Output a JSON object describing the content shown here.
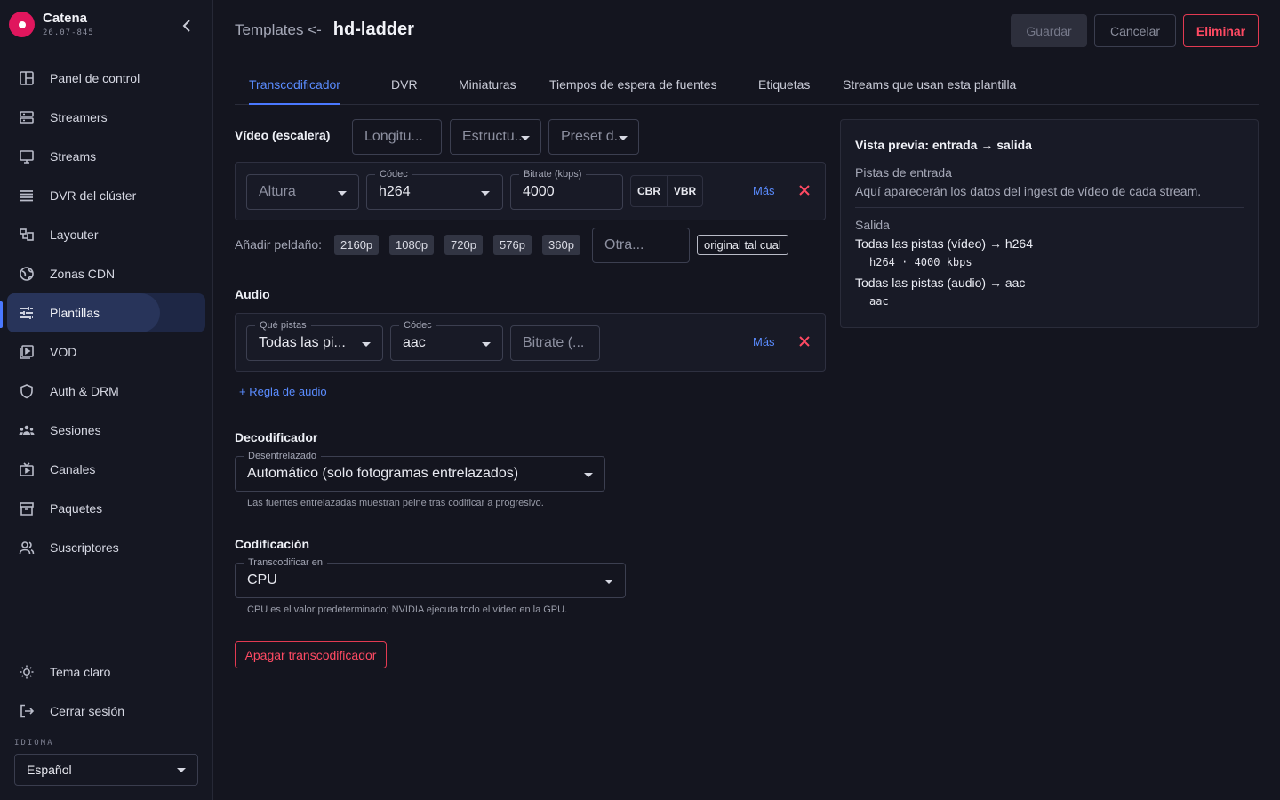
{
  "brand": {
    "name": "Catena",
    "version": "26.07-845",
    "logo_color": "#e0165d"
  },
  "sidebar": {
    "items": [
      {
        "label": "Panel de control",
        "icon": "dashboard-icon"
      },
      {
        "label": "Streamers",
        "icon": "server-icon"
      },
      {
        "label": "Streams",
        "icon": "monitor-icon"
      },
      {
        "label": "DVR del clúster",
        "icon": "list-icon"
      },
      {
        "label": "Layouter",
        "icon": "layout-icon"
      },
      {
        "label": "Zonas CDN",
        "icon": "globe-icon"
      },
      {
        "label": "Plantillas",
        "icon": "sliders-icon",
        "active": true
      },
      {
        "label": "VOD",
        "icon": "video-library-icon"
      },
      {
        "label": "Auth & DRM",
        "icon": "shield-icon"
      },
      {
        "label": "Sesiones",
        "icon": "group-icon"
      },
      {
        "label": "Canales",
        "icon": "tv-icon"
      },
      {
        "label": "Paquetes",
        "icon": "archive-icon"
      },
      {
        "label": "Suscriptores",
        "icon": "users-icon"
      }
    ],
    "theme_label": "Tema claro",
    "logout_label": "Cerrar sesión",
    "language_label": "IDIOMA",
    "language_value": "Español"
  },
  "header": {
    "breadcrumb": "Templates <-",
    "title": "hd-ladder",
    "save_label": "Guardar",
    "cancel_label": "Cancelar",
    "delete_label": "Eliminar"
  },
  "tabs": [
    {
      "label": "Transcodificador",
      "active": true
    },
    {
      "label": "DVR"
    },
    {
      "label": "Miniaturas"
    },
    {
      "label": "Tiempos de espera de fuentes"
    },
    {
      "label": "Etiquetas"
    },
    {
      "label": "Streams que usan esta plantilla"
    }
  ],
  "video": {
    "title": "Vídeo (escalera)",
    "gop_placeholder": "Longitu...",
    "structure_placeholder": "Estructu...",
    "preset_placeholder": "Preset d...",
    "row": {
      "height_placeholder": "Altura",
      "codec_label": "Códec",
      "codec_value": "h264",
      "bitrate_label": "Bitrate (kbps)",
      "bitrate_value": "4000",
      "cbr_label": "CBR",
      "vbr_label": "VBR",
      "more_label": "Más"
    },
    "add_step_label": "Añadir peldaño:",
    "steps": [
      "2160p",
      "1080p",
      "720p",
      "576p",
      "360p"
    ],
    "other_placeholder": "Otra...",
    "original_label": "original tal cual"
  },
  "audio": {
    "title": "Audio",
    "tracks_label": "Qué pistas",
    "tracks_value": "Todas las pi...",
    "codec_label": "Códec",
    "codec_value": "aac",
    "bitrate_placeholder": "Bitrate (...",
    "more_label": "Más",
    "add_rule_label": "+ Regla de audio"
  },
  "decoder": {
    "title": "Decodificador",
    "deinterlace_label": "Desentrelazado",
    "deinterlace_value": "Automático (solo fotogramas entrelazados)",
    "helper": "Las fuentes entrelazadas muestran peine tras codificar a progresivo."
  },
  "encoding": {
    "title": "Codificación",
    "transcode_label": "Transcodificar en",
    "transcode_value": "CPU",
    "helper": "CPU es el valor predeterminado; NVIDIA ejecuta todo el vídeo en la GPU."
  },
  "disable_transcoder_label": "Apagar transcodificador",
  "preview": {
    "title": "Vista previa: entrada → salida",
    "input_title": "Pistas de entrada",
    "input_text": "Aquí aparecerán los datos del ingest de vídeo de cada stream.",
    "output_title": "Salida",
    "video_line": "Todas las pistas (vídeo) → h264",
    "video_detail": "h264 · 4000 kbps",
    "audio_line": "Todas las pistas (audio) → aac",
    "audio_detail": "aac"
  },
  "colors": {
    "accent": "#4a78ff",
    "danger": "#e23a52",
    "background": "#14151f"
  }
}
